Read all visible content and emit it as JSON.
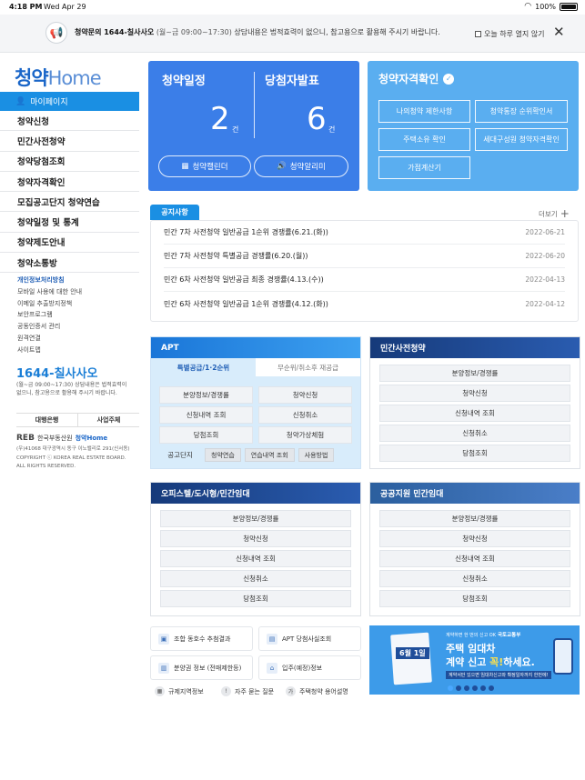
{
  "status": {
    "time": "4:18 PM",
    "date": "Wed Apr 29",
    "battery": "100%"
  },
  "notice_bar": {
    "bold": "청약문의 1644-칠사사오",
    "hours": "(월~금 09:00~17:30)",
    "desc": "상담내용은 법적효력이 없으니, 참고용으로 활용해 주시기 바랍니다.",
    "checkbox_label": "오늘 하루 열지 않기"
  },
  "logo": {
    "kor": "청약",
    "eng": "Home"
  },
  "sidebar": {
    "mypage": "마이페이지",
    "items": [
      "청약신청",
      "민간사전청약",
      "청약당첨조회",
      "청약자격확인",
      "모집공고단지 청약연습",
      "청약일정 및 통계",
      "청약제도안내",
      "청약소통방"
    ],
    "sub_items": [
      "개인정보처리방침",
      "모바일 사용에 대한 안내",
      "이메일 추출방지정책",
      "보안프로그램",
      "공동인증서 관리",
      "원격연결",
      "사이트맵"
    ],
    "phone": "1644-칠사사오",
    "phone_desc": "(월~금 09:00~17:30) 상담내용은 법적효력이 없으니, 참고용으로 활용해 주시기 바랍니다.",
    "buttons": [
      "대행은행",
      "사업주체"
    ],
    "corp_logo": "REB",
    "corp_name": "한국부동산원",
    "corp_brand": "청약Home",
    "address": "(우)41068 대구광역시 동구 이노밸리로 291(신서동)",
    "copyright": "COPYRIGHT ⓒ KOREA REAL ESTATE BOARD.",
    "rights": "ALL RIGHTS RESERVED."
  },
  "schedule": {
    "title1": "청약일정",
    "title2": "당첨자발표",
    "count1": "2",
    "unit1": "건",
    "count2": "6",
    "unit2": "건",
    "btn1": "청약캘린더",
    "btn2": "청약알리미"
  },
  "qualification": {
    "title": "청약자격확인",
    "buttons": [
      "나의청약 제한사항",
      "청약통장 순위확인서",
      "주택소유 확인",
      "세대구성원 청약자격확인",
      "가점계산기"
    ]
  },
  "notices": {
    "tab": "공지사항",
    "more": "더보기",
    "rows": [
      {
        "title": "민간 7차 사전청약 일반공급 1순위 경쟁률(6.21.(화))",
        "date": "2022-06-21"
      },
      {
        "title": "민간 7차 사전청약 특별공급 경쟁률(6.20.(월))",
        "date": "2022-06-20"
      },
      {
        "title": "민간 6차 사전청약 일반공급 최종 경쟁률(4.13.(수))",
        "date": "2022-04-13"
      },
      {
        "title": "민간 6차 사전청약 일반공급 1순위 경쟁률(4.12.(화))",
        "date": "2022-04-12"
      }
    ]
  },
  "apt": {
    "title": "APT",
    "tab_active": "특별공급/1·2순위",
    "tab_inactive": "무순위/취소후 재공급",
    "cells": [
      "분양정보/경쟁률",
      "청약신청",
      "신청내역 조회",
      "신청취소",
      "당첨조회",
      "청약가상체험"
    ],
    "ga_label": "공고단지",
    "ga_pills": [
      "청약연습",
      "연습내역 조회",
      "사용방법"
    ]
  },
  "private_pre": {
    "title": "민간사전청약",
    "items": [
      "분양정보/경쟁률",
      "청약신청",
      "신청내역 조회",
      "신청취소",
      "당첨조회"
    ]
  },
  "officetel": {
    "title": "오피스텔/도시형/민간임대",
    "items": [
      "분양정보/경쟁률",
      "청약신청",
      "신청내역 조회",
      "신청취소",
      "당첨조회"
    ]
  },
  "public_rental": {
    "title": "공공지원 민간임대",
    "items": [
      "분양정보/경쟁률",
      "청약신청",
      "신청내역 조회",
      "신청취소",
      "당첨조회"
    ]
  },
  "quick_links": {
    "l1": "조합 동호수 추첨결과",
    "l2": "APT 당첨사실조회",
    "l3": "분양권 정보 (전매제한등)",
    "l4": "입주(예정)정보",
    "s1": "규제지역정보",
    "s2": "자주 묻는 질문",
    "s3": "주택청약 용어설명"
  },
  "banner": {
    "small": "계약하면 한 번의 신고 OK",
    "gov": "국토교통부",
    "doc_date": "6월 1일",
    "line1": "주택 임대차",
    "line2a": "계약 신고 ",
    "line2b": "꼭!",
    "line2c": "하세요.",
    "sub": "계약서만 있으면 임대차신고와 확정일자까지 한번에!"
  },
  "colors": {
    "primary": "#1a8fe3",
    "schedule_bg": "#3b7ee8",
    "qual_bg": "#5aaef0",
    "dark_navy": "#163a7a"
  }
}
